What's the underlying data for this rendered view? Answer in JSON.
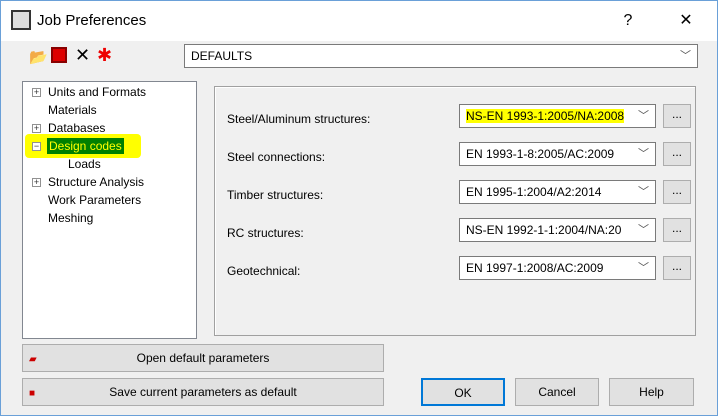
{
  "window": {
    "title": "Job Preferences",
    "help_label": "?",
    "close_label": "✕"
  },
  "toolbar": {
    "icons": [
      "open-folder-icon",
      "save-icon",
      "delete-icon",
      "reset-icon"
    ],
    "preset": "DEFAULTS"
  },
  "tree": [
    {
      "label": "Units and Formats",
      "expander": "+"
    },
    {
      "label": "Materials"
    },
    {
      "label": "Databases",
      "expander": "+"
    },
    {
      "label": "Design codes",
      "expander": "−",
      "selected": true
    },
    {
      "label": "Loads"
    },
    {
      "label": "Structure Analysis",
      "expander": "+"
    },
    {
      "label": "Work Parameters"
    },
    {
      "label": "Meshing"
    }
  ],
  "codes": [
    {
      "label": "Steel/Aluminum structures:",
      "value": "NS-EN 1993-1:2005/NA:2008"
    },
    {
      "label": "Steel connections:",
      "value": "EN 1993-1-8:2005/AC:2009"
    },
    {
      "label": "Timber structures:",
      "value": "EN 1995-1:2004/A2:2014"
    },
    {
      "label": "RC structures:",
      "value": "NS-EN 1992-1-1:2004/NA:20"
    },
    {
      "label": "Geotechnical:",
      "value": "EN 1997-1:2008/AC:2009"
    }
  ],
  "more_label": "...",
  "buttons": {
    "open_default": "Open default parameters",
    "save_default": "Save current parameters as default",
    "ok": "OK",
    "cancel": "Cancel",
    "help": "Help"
  },
  "colors": {
    "highlight": "#ffff00",
    "selection": "#008000"
  }
}
